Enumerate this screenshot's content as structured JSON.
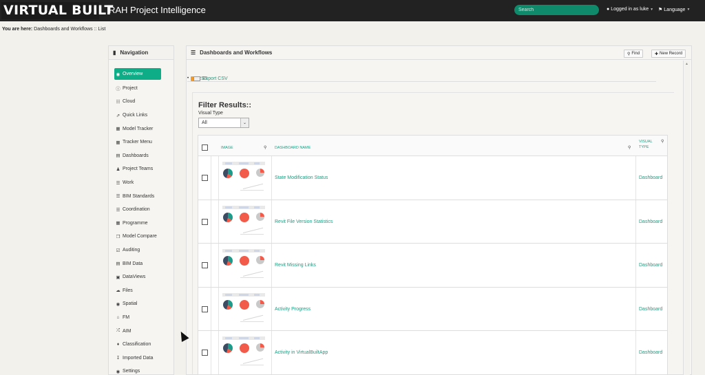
{
  "header": {
    "logo": "VIRTUAL BUILT",
    "app_title": "RAH Project Intelligence",
    "search_placeholder": "Search",
    "login_text": "Logged in as luke",
    "language_text": "Language"
  },
  "breadcrumb": {
    "prefix": "You are here:",
    "path": "Dashboards and Workflows :: List"
  },
  "navigation": {
    "title": "Navigation",
    "items": [
      {
        "label": "Overview",
        "icon": "dashboard-icon",
        "active": true
      },
      {
        "label": "Project",
        "icon": "info-icon"
      },
      {
        "label": "Cloud",
        "icon": "sitemap-icon"
      },
      {
        "label": "Quick Links",
        "icon": "external-link-icon"
      },
      {
        "label": "Model Tracker",
        "icon": "grid-icon"
      },
      {
        "label": "Tracker Menu",
        "icon": "grid-icon"
      },
      {
        "label": "Dashboards",
        "icon": "chart-icon"
      },
      {
        "label": "Project Teams",
        "icon": "users-icon"
      },
      {
        "label": "Work",
        "icon": "list-icon"
      },
      {
        "label": "BIM Standards",
        "icon": "list-icon"
      },
      {
        "label": "Coordination",
        "icon": "list-icon"
      },
      {
        "label": "Programme",
        "icon": "calendar-icon"
      },
      {
        "label": "Model Compare",
        "icon": "copy-icon"
      },
      {
        "label": "Auditing",
        "icon": "check-icon"
      },
      {
        "label": "BIM Data",
        "icon": "chart-icon"
      },
      {
        "label": "DataViews",
        "icon": "film-icon"
      },
      {
        "label": "Files",
        "icon": "folder-icon"
      },
      {
        "label": "Spatial",
        "icon": "map-marker-icon"
      },
      {
        "label": "FM",
        "icon": "home-icon"
      },
      {
        "label": "AIM",
        "icon": "random-icon"
      },
      {
        "label": "Classification",
        "icon": "tags-icon"
      },
      {
        "label": "Imported Data",
        "icon": "download-icon"
      },
      {
        "label": "Settings",
        "icon": "lock-icon"
      }
    ]
  },
  "main": {
    "title": "Dashboards and Workflows",
    "find_label": "Find",
    "new_record_label": "New Record",
    "rss_label": "RSS",
    "export_label": "Export CSV",
    "filter_title": "Filter Results::",
    "visual_type_label": "Visual Type",
    "visual_type_value": "All",
    "columns": {
      "image": "IMAGE",
      "name": "DASHBOARD NAME",
      "type_line1": "VISUAL",
      "type_line2": "TYPE"
    },
    "rows": [
      {
        "name": "State Modification Status",
        "type": "Dashboard"
      },
      {
        "name": "Revit File Version Statistics",
        "type": "Dashboard"
      },
      {
        "name": "Revit Missing Links",
        "type": "Dashboard"
      },
      {
        "name": "Activity Progress",
        "type": "Dashboard"
      },
      {
        "name": "Activity in VirtualBuiltApp",
        "type": "Dashboard"
      }
    ]
  },
  "colors": {
    "accent": "#0fad87",
    "link": "#1d9c80",
    "header_bg": "#222222"
  }
}
